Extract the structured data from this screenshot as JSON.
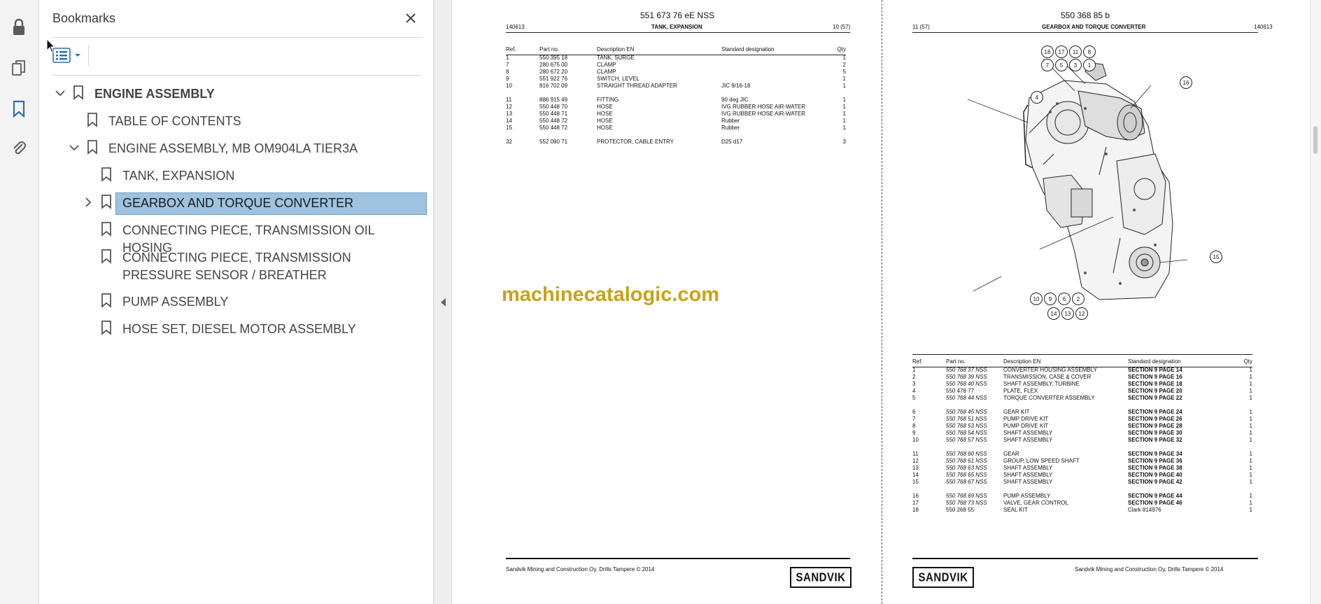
{
  "sidebar_icons": [
    {
      "name": "lock-icon"
    },
    {
      "name": "pages-icon"
    },
    {
      "name": "bookmark-icon"
    },
    {
      "name": "attachment-icon"
    }
  ],
  "bookmarks": {
    "title": "Bookmarks",
    "items": [
      {
        "label": "ENGINE ASSEMBLY",
        "level": 0,
        "expanded": true
      },
      {
        "label": "TABLE OF CONTENTS",
        "level": 1
      },
      {
        "label": "ENGINE ASSEMBLY, MB OM904LA TIER3A",
        "level": 1,
        "expanded": true
      },
      {
        "label": "TANK, EXPANSION",
        "level": 2
      },
      {
        "label": "GEARBOX AND TORQUE CONVERTER",
        "level": 2,
        "selected": true,
        "collapsed": true
      },
      {
        "label": "CONNECTING PIECE, TRANSMISSION OIL HOSING",
        "level": 2
      },
      {
        "label": "CONNECTING PIECE, TRANSMISSION PRESSURE SENSOR / BREATHER",
        "level": 2
      },
      {
        "label": "PUMP ASSEMBLY",
        "level": 2
      },
      {
        "label": "HOSE SET, DIESEL MOTOR ASSEMBLY",
        "level": 2
      }
    ]
  },
  "left_page": {
    "doc_number": "551 673 76 eE NSS",
    "date": "140613",
    "title": "TANK, EXPANSION",
    "page": "10 (57)",
    "headers": {
      "ref": "Ref.",
      "part": "Part no.",
      "desc": "Description EN",
      "std": "Standard designation",
      "qty": "Qty"
    },
    "groups": [
      [
        {
          "ref": "1",
          "part": "550 395 18",
          "desc": "TANK, SURGE",
          "std": "",
          "qty": "1"
        },
        {
          "ref": "7",
          "part": "280 675 00",
          "desc": "CLAMP",
          "std": "",
          "qty": "2"
        },
        {
          "ref": "8",
          "part": "280 672 20",
          "desc": "CLAMP",
          "std": "",
          "qty": "5"
        },
        {
          "ref": "9",
          "part": "551 922 76",
          "desc": "SWITCH, LEVEL",
          "std": "",
          "qty": "1"
        },
        {
          "ref": "10",
          "part": "816 702 09",
          "desc": "STRAIGHT THREAD ADAPTER",
          "std": "JIC 9/16-18",
          "qty": "1"
        }
      ],
      [
        {
          "ref": "11",
          "part": "886 915 49",
          "desc": "FITTING",
          "std": "90 deg JIC",
          "qty": "1"
        },
        {
          "ref": "12",
          "part": "550 448 70",
          "desc": "HOSE",
          "std": "IVG RUBBER HOSE AIR-WATER",
          "qty": "1"
        },
        {
          "ref": "13",
          "part": "550 448 71",
          "desc": "HOSE",
          "std": "IVG RUBBER HOSE AIR-WATER",
          "qty": "1"
        },
        {
          "ref": "14",
          "part": "550 448 72",
          "desc": "HOSE",
          "std": "Rubber",
          "qty": "1"
        },
        {
          "ref": "15",
          "part": "550 448 72",
          "desc": "HOSE",
          "std": "Rubber",
          "qty": "1"
        }
      ],
      [
        {
          "ref": "32",
          "part": "552 090 71",
          "desc": "PROTECTOR, CABLE ENTRY",
          "std": "D25 d17",
          "qty": "3"
        }
      ]
    ],
    "footer": "Sandvik Mining and Construction Oy, Drills Tampere © 2014",
    "logo": "SANDVIK"
  },
  "right_page": {
    "doc_number": "550 368 85 b",
    "page": "11 (57)",
    "title": "GEARBOX AND TORQUE CONVERTER",
    "date": "140613",
    "callouts": [
      "18",
      "17",
      "11",
      "8",
      "7",
      "5",
      "3",
      "1",
      "4",
      "16",
      "15",
      "10",
      "9",
      "6",
      "2",
      "14",
      "13",
      "12"
    ],
    "headers": {
      "ref": "Ref.",
      "part": "Part no.",
      "desc": "Description EN",
      "std": "Standard designation",
      "qty": "Qty"
    },
    "groups": [
      [
        {
          "ref": "1",
          "part": "550 768 37 NSS",
          "desc": "CONVERTER HOUSING ASSEMBLY",
          "std": "SECTION 9 PAGE 14",
          "qty": "1"
        },
        {
          "ref": "2",
          "part": "550 768 39 NSS",
          "desc": "TRANSMISSION, CASE & COVER",
          "std": "SECTION 9 PAGE 16",
          "qty": "1"
        },
        {
          "ref": "3",
          "part": "550 768 40 NSS",
          "desc": "SHAFT ASSEMBLY, TURBINE",
          "std": "SECTION 9 PAGE 18",
          "qty": "1"
        },
        {
          "ref": "4",
          "part": "550 478 77",
          "desc": "PLATE, FLEX",
          "std": "SECTION 9 PAGE 20",
          "qty": "1"
        },
        {
          "ref": "5",
          "part": "550 768 44 NSS",
          "desc": "TORQUE CONVERTER ASSEMBLY",
          "std": "SECTION 9 PAGE 22",
          "qty": "1"
        }
      ],
      [
        {
          "ref": "6",
          "part": "550 768 45 NSS",
          "desc": "GEAR KIT",
          "std": "SECTION 9 PAGE 24",
          "qty": "1"
        },
        {
          "ref": "7",
          "part": "550 768 51 NSS",
          "desc": "PUMP DRIVE KIT",
          "std": "SECTION 9 PAGE 26",
          "qty": "1"
        },
        {
          "ref": "8",
          "part": "550 768 53 NSS",
          "desc": "PUMP DRIVE KIT",
          "std": "SECTION 9 PAGE 28",
          "qty": "1"
        },
        {
          "ref": "9",
          "part": "550 768 54 NSS",
          "desc": "SHAFT ASSEMBLY",
          "std": "SECTION 9 PAGE 30",
          "qty": "1"
        },
        {
          "ref": "10",
          "part": "550 768 57 NSS",
          "desc": "SHAFT ASSEMBLY",
          "std": "SECTION 9 PAGE 32",
          "qty": "1"
        }
      ],
      [
        {
          "ref": "11",
          "part": "550 768 60 NSS",
          "desc": "GEAR",
          "std": "SECTION 9 PAGE 34",
          "qty": "1"
        },
        {
          "ref": "12",
          "part": "550 768 61 NSS",
          "desc": "GROUP, LOW SPEED SHAFT",
          "std": "SECTION 9 PAGE 36",
          "qty": "1"
        },
        {
          "ref": "13",
          "part": "550 768 63 NSS",
          "desc": "SHAFT ASSEMBLY",
          "std": "SECTION 9 PAGE 38",
          "qty": "1"
        },
        {
          "ref": "14",
          "part": "550 768 65 NSS",
          "desc": "SHAFT ASSEMBLY",
          "std": "SECTION 9 PAGE 40",
          "qty": "1"
        },
        {
          "ref": "15",
          "part": "550 768 67 NSS",
          "desc": "SHAFT ASSEMBLY",
          "std": "SECTION 9 PAGE 42",
          "qty": "1"
        }
      ],
      [
        {
          "ref": "16",
          "part": "550 768 69 NSS",
          "desc": "PUMP ASSEMBLY",
          "std": "SECTION 9 PAGE 44",
          "qty": "1"
        },
        {
          "ref": "17",
          "part": "550 768 73 NSS",
          "desc": "VALVE, GEAR CONTROL",
          "std": "SECTION 9 PAGE 46",
          "qty": "1"
        },
        {
          "ref": "18",
          "part": "550 268 55",
          "desc": "SEAL KIT",
          "std": "Clark 814976",
          "qty": "1"
        }
      ]
    ],
    "footer": "Sandvik Mining and Construction Oy, Drills Tampere © 2014",
    "logo": "SANDVIK"
  },
  "watermark": "machinecatalogic.com",
  "colors": {
    "selection": "#9fc3df",
    "watermark": "#c9a217",
    "bookmark_icon": "#2f6fad"
  }
}
